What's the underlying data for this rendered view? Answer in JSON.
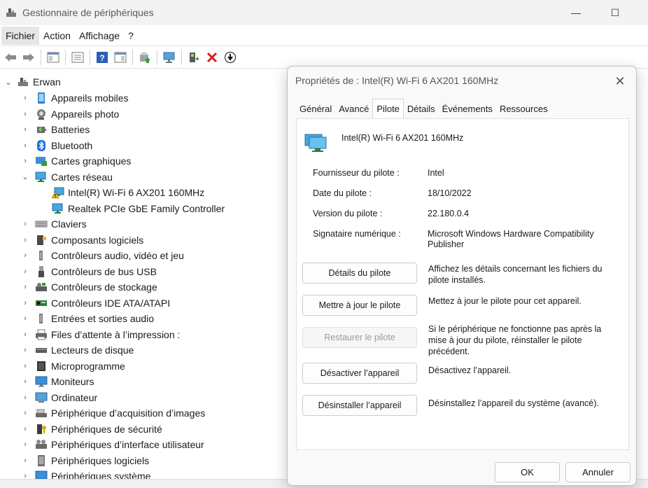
{
  "window": {
    "title": "Gestionnaire de périphériques",
    "minimize_glyph": "—",
    "maximize_glyph": "☐"
  },
  "menu": {
    "items": [
      "Fichier",
      "Action",
      "Affichage",
      "?"
    ]
  },
  "toolbar": {
    "icons": [
      "back-icon",
      "forward-icon",
      "show-hide-tree-icon",
      "properties-icon",
      "help-icon",
      "view-icon",
      "update-driver-icon",
      "scan-hardware-icon",
      "add-driver-icon",
      "uninstall-device-icon",
      "disable-device-icon"
    ]
  },
  "tree": {
    "root": "Erwan",
    "items": [
      {
        "label": "Appareils mobiles",
        "icon": "phone-icon",
        "expander": "›"
      },
      {
        "label": "Appareils photo",
        "icon": "camera-icon",
        "expander": "›"
      },
      {
        "label": "Batteries",
        "icon": "battery-icon",
        "expander": "›"
      },
      {
        "label": "Bluetooth",
        "icon": "bluetooth-icon",
        "expander": "›"
      },
      {
        "label": "Cartes graphiques",
        "icon": "display-adapter-icon",
        "expander": "›"
      },
      {
        "label": "Cartes réseau",
        "icon": "network-adapter-icon",
        "expander": "⌄"
      },
      {
        "label": "Intel(R) Wi-Fi 6 AX201 160MHz",
        "icon": "network-warning-icon",
        "expander": ""
      },
      {
        "label": "Realtek PCIe GbE Family Controller",
        "icon": "network-adapter-icon",
        "expander": ""
      },
      {
        "label": "Claviers",
        "icon": "keyboard-icon",
        "expander": "›"
      },
      {
        "label": "Composants logiciels",
        "icon": "software-component-icon",
        "expander": "›"
      },
      {
        "label": "Contrôleurs audio, vidéo et jeu",
        "icon": "speaker-icon",
        "expander": "›"
      },
      {
        "label": "Contrôleurs de bus USB",
        "icon": "usb-icon",
        "expander": "›"
      },
      {
        "label": "Contrôleurs de stockage",
        "icon": "storage-controller-icon",
        "expander": "›"
      },
      {
        "label": "Contrôleurs IDE ATA/ATAPI",
        "icon": "ide-controller-icon",
        "expander": "›"
      },
      {
        "label": "Entrées et sorties audio",
        "icon": "speaker-icon",
        "expander": "›"
      },
      {
        "label": "Files d’attente à l’impression :",
        "icon": "printer-icon",
        "expander": "›"
      },
      {
        "label": "Lecteurs de disque",
        "icon": "disk-drive-icon",
        "expander": "›"
      },
      {
        "label": "Microprogramme",
        "icon": "firmware-icon",
        "expander": "›"
      },
      {
        "label": "Moniteurs",
        "icon": "monitor-icon",
        "expander": "›"
      },
      {
        "label": "Ordinateur",
        "icon": "computer-icon",
        "expander": "›"
      },
      {
        "label": "Périphérique d’acquisition d’images",
        "icon": "scanner-icon",
        "expander": "›"
      },
      {
        "label": "Périphériques de sécurité",
        "icon": "security-device-icon",
        "expander": "›"
      },
      {
        "label": "Périphériques d’interface utilisateur",
        "icon": "hid-icon",
        "expander": "›"
      },
      {
        "label": "Périphériques logiciels",
        "icon": "software-device-icon",
        "expander": "›"
      },
      {
        "label": "Périphériques système",
        "icon": "system-device-icon",
        "expander": "›"
      }
    ]
  },
  "dialog": {
    "title": "Propriétés de : Intel(R) Wi-Fi 6 AX201 160MHz",
    "close_glyph": "✕",
    "tabs": [
      "Général",
      "Avancé",
      "Pilote",
      "Détails",
      "Événements",
      "Ressources"
    ],
    "active_tab": "Pilote",
    "device_name": "Intel(R) Wi-Fi 6 AX201 160MHz",
    "properties": [
      {
        "label": "Fournisseur du pilote :",
        "value": "Intel"
      },
      {
        "label": "Date du pilote :",
        "value": "18/10/2022"
      },
      {
        "label": "Version du pilote :",
        "value": "22.180.0.4"
      },
      {
        "label": "Signataire numérique :",
        "value": "Microsoft Windows Hardware Compatibility Publisher"
      }
    ],
    "actions": [
      {
        "label": "Détails du pilote",
        "desc": "Affichez les détails concernant les fichiers du pilote installés.",
        "enabled": true
      },
      {
        "label": "Mettre à jour le pilote",
        "desc": "Mettez à jour le pilote pour cet appareil.",
        "enabled": true
      },
      {
        "label": "Restaurer le pilote",
        "desc": "Si le périphérique ne fonctionne pas après la mise à jour du pilote, réinstaller le pilote précédent.",
        "enabled": false
      },
      {
        "label": "Désactiver l’appareil",
        "desc": "Désactivez l’appareil.",
        "enabled": true
      },
      {
        "label": "Désinstaller l’appareil",
        "desc": "Désinstallez l’appareil du système (avancé).",
        "enabled": true
      }
    ],
    "ok_label": "OK",
    "cancel_label": "Annuler"
  }
}
